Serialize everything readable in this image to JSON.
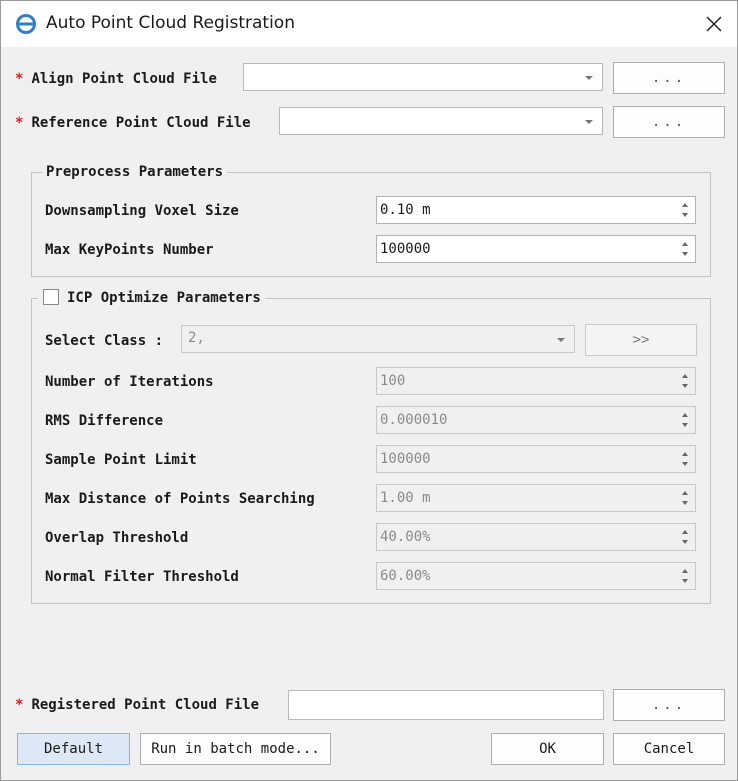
{
  "window": {
    "title": "Auto Point Cloud Registration"
  },
  "align_file": {
    "label": "Align Point Cloud File",
    "required_mark": "*",
    "value": "",
    "browse_label": "..."
  },
  "reference_file": {
    "label": "Reference Point Cloud File",
    "required_mark": "*",
    "value": "",
    "browse_label": "..."
  },
  "preprocess": {
    "title": "Preprocess Parameters",
    "downsampling": {
      "label": "Downsampling Voxel Size",
      "value": "0.10 m"
    },
    "max_keypoints": {
      "label": "Max KeyPoints Number",
      "value": "100000"
    }
  },
  "icp": {
    "title": "ICP Optimize Parameters",
    "checked": false,
    "select_class": {
      "label": "Select Class :",
      "value": "2,",
      "button_label": ">>"
    },
    "iterations": {
      "label": "Number of Iterations",
      "value": "100"
    },
    "rms": {
      "label": "RMS Difference",
      "value": "0.000010"
    },
    "sample_limit": {
      "label": "Sample Point Limit",
      "value": "100000"
    },
    "max_distance": {
      "label": "Max Distance of Points Searching",
      "value": "1.00 m"
    },
    "overlap": {
      "label": "Overlap Threshold",
      "value": "40.00%"
    },
    "normal_filter": {
      "label": "Normal Filter Threshold",
      "value": "60.00%"
    }
  },
  "registered_file": {
    "label": "Registered Point Cloud File",
    "required_mark": "*",
    "value": "",
    "browse_label": "..."
  },
  "footer": {
    "default_label": "Default",
    "batch_label": "Run in batch mode...",
    "ok_label": "OK",
    "cancel_label": "Cancel"
  }
}
